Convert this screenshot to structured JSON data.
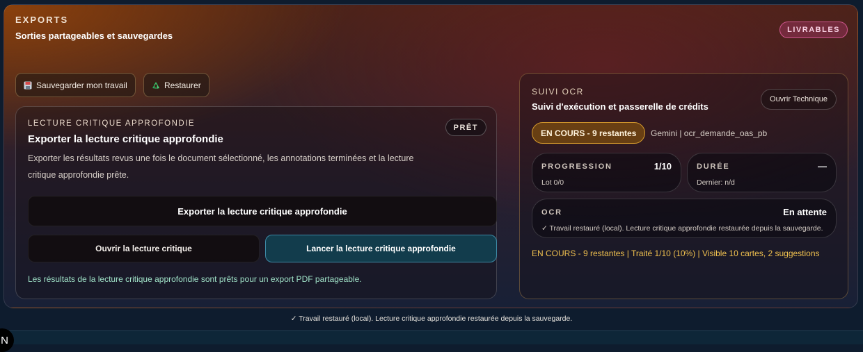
{
  "section": {
    "eyebrow": "EXPORTS",
    "subtitle": "Sorties partageables et sauvegardes",
    "badge": "LIVRABLES"
  },
  "toolbar": {
    "save_label": "Sauvegarder mon travail",
    "save_icon": "floppy-disk-icon",
    "restore_label": "Restaurer",
    "restore_icon": "recycle-icon"
  },
  "lecture": {
    "eyebrow": "LECTURE CRITIQUE APPROFONDIE",
    "title": "Exporter la lecture critique approfondie",
    "description": "Exporter les résultats revus une fois le document sélectionné, les annotations terminées et la lecture critique approfondie prête.",
    "status_badge": "PRÊT",
    "export_button": "Exporter la lecture critique approfondie",
    "open_button": "Ouvrir la lecture critique",
    "launch_button": "Lancer la lecture critique approfondie",
    "note": "Les résultats de la lecture critique approfondie sont prêts pour un export PDF partageable."
  },
  "ocr": {
    "eyebrow": "SUIVI OCR",
    "title": "Suivi d'exécution et passerelle de crédits",
    "tech_button": "Ouvrir Technique",
    "status_pill": "EN COURS - 9 restantes",
    "meta": "Gemini | ocr_demande_oas_pb",
    "progression": {
      "label": "PROGRESSION",
      "value": "1/10",
      "sub": "Lot 0/0"
    },
    "duree": {
      "label": "DURÉE",
      "value": "—",
      "sub": "Dernier: n/d"
    },
    "ocr_stat": {
      "label": "OCR",
      "value": "En attente",
      "sub": "✓ Travail restauré (local). Lecture critique approfondie restaurée depuis la sauvegarde."
    },
    "summary": "EN COURS - 9 restantes | Traité 1/10 (10%) | Visible 10 cartes, 2 suggestions"
  },
  "footer": {
    "message": "✓ Travail restauré (local). Lecture critique approfondie restaurée depuis la sauvegarde.",
    "corner_letter": "N"
  },
  "colors": {
    "accent_gold": "#f0c14f",
    "accent_teal": "#123c4c",
    "badge_pink": "#d0568f",
    "note_green": "#9fe0c6"
  }
}
